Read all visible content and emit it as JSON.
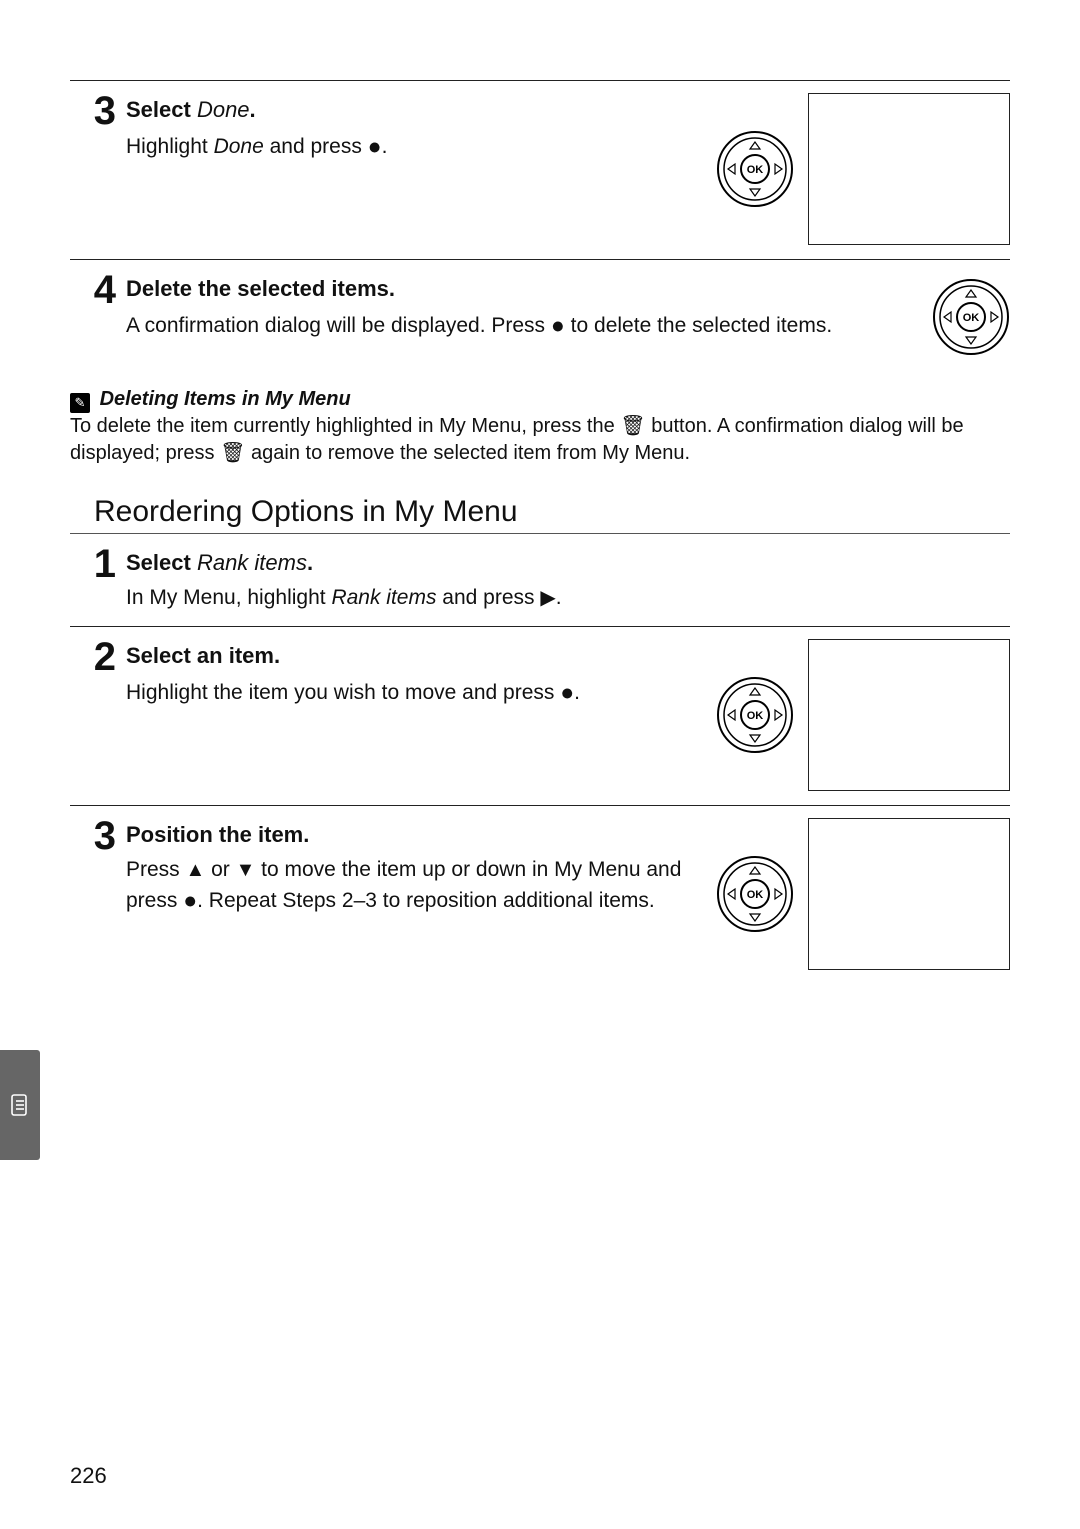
{
  "page_number": "226",
  "step3a": {
    "num": "3",
    "title_strong": "Select",
    "title_italic": "Done",
    "title_suffix": ".",
    "desc_prefix": "Highlight ",
    "desc_italic": "Done",
    "desc_mid": " and press ",
    "desc_suffix": "."
  },
  "step4": {
    "num": "4",
    "title": "Delete the selected items.",
    "desc_a": "A confirmation dialog will be displayed.  Press ",
    "desc_b": " to delete the selected items."
  },
  "note": {
    "heading": "Deleting Items in My Menu",
    "line1_a": "To delete the item currently highlighted in My Menu, press the ",
    "line1_b": " button.  A confirmation dialog will be displayed; press ",
    "line1_c": " again to remove the selected item from My Menu."
  },
  "section_title": "Reordering Options in My Menu",
  "step1": {
    "num": "1",
    "title_strong": "Select",
    "title_italic": "Rank items",
    "title_suffix": ".",
    "desc_a": "In My Menu, highlight ",
    "desc_italic": "Rank items",
    "desc_b": "  and press ",
    "desc_suffix": "."
  },
  "step2": {
    "num": "2",
    "title": "Select an item.",
    "desc_a": "Highlight the item you wish to move and press ",
    "desc_suffix": "."
  },
  "step3b": {
    "num": "3",
    "title": "Position the item.",
    "desc_a": "Press ",
    "desc_b": " or ",
    "desc_c": " to move the item up or down in My Menu and press ",
    "desc_d": ".  Repeat Steps 2–3 to reposition additional items."
  },
  "dpad_label": "OK"
}
